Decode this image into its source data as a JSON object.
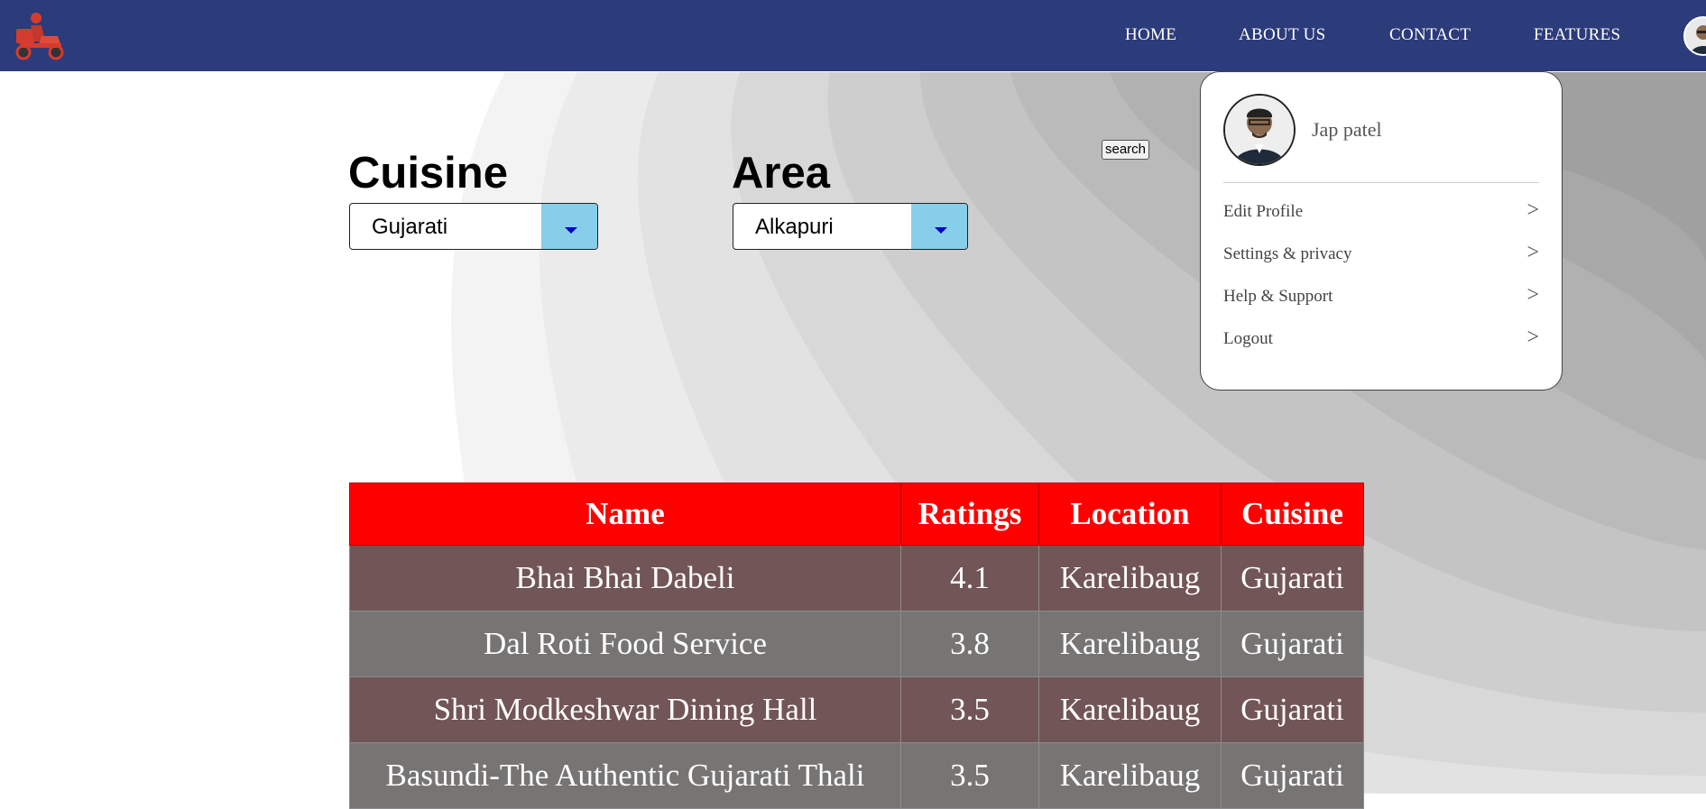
{
  "nav": {
    "links": [
      "HOME",
      "ABOUT US",
      "CONTACT",
      "FEATURES"
    ],
    "logo_icon": "delivery-scooter-logo",
    "avatar_icon": "user-avatar"
  },
  "filters": {
    "cuisine_label": "Cuisine",
    "cuisine_value": "Gujarati",
    "area_label": "Area",
    "area_value": "Alkapuri",
    "search_label": "search"
  },
  "profile_menu": {
    "user_name": "Jap patel",
    "items": [
      {
        "label": "Edit Profile",
        "chevron": ">"
      },
      {
        "label": "Settings & privacy",
        "chevron": ">"
      },
      {
        "label": "Help & Support",
        "chevron": ">"
      },
      {
        "label": "Logout",
        "chevron": ">"
      }
    ]
  },
  "table": {
    "headers": [
      "Name",
      "Ratings",
      "Location",
      "Cuisine"
    ],
    "rows": [
      [
        "Bhai Bhai Dabeli",
        "4.1",
        "Karelibaug",
        "Gujarati"
      ],
      [
        "Dal Roti Food Service",
        "3.8",
        "Karelibaug",
        "Gujarati"
      ],
      [
        "Shri Modkeshwar Dining Hall",
        "3.5",
        "Karelibaug",
        "Gujarati"
      ],
      [
        "Basundi-The Authentic Gujarati Thali",
        "3.5",
        "Karelibaug",
        "Gujarati"
      ]
    ]
  },
  "colors": {
    "navbar": "#2c3b7a",
    "table_header": "#ff0000",
    "row_odd": "#725556",
    "row_even": "#777574",
    "select_arrow_bg": "#87ceeb"
  }
}
